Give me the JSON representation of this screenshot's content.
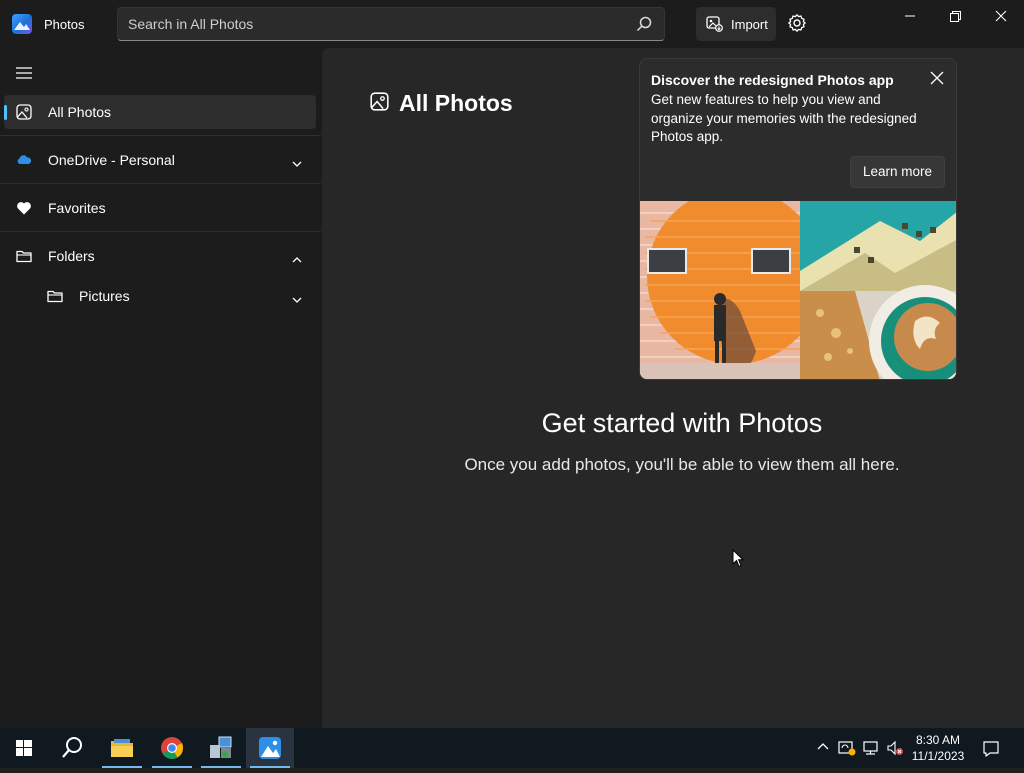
{
  "window": {
    "app_title": "Photos",
    "search_placeholder": "Search in All Photos",
    "import_label": "Import"
  },
  "sidebar": {
    "items": [
      {
        "label": "All Photos",
        "icon": "photo-icon",
        "selected": true
      },
      {
        "label": "OneDrive - Personal",
        "icon": "cloud-icon",
        "expanded": false
      },
      {
        "label": "Favorites",
        "icon": "heart-icon"
      },
      {
        "label": "Folders",
        "icon": "folder-icon",
        "expanded": true
      },
      {
        "label": "Pictures",
        "icon": "folder-icon",
        "expanded": false
      }
    ]
  },
  "main": {
    "page_title": "All Photos",
    "empty_title": "Get started with Photos",
    "empty_subtitle": "Once you add photos, you'll be able to view them all here."
  },
  "tip": {
    "title": "Discover the redesigned Photos app",
    "body": "Get new features to help you view and organize your memories with the redesigned Photos app.",
    "button": "Learn more"
  },
  "taskbar": {
    "apps": [
      "start-icon",
      "search-icon",
      "file-explorer-icon",
      "chrome-icon",
      "control-panel-icon",
      "photos-icon"
    ],
    "time": "8:30 AM",
    "date": "11/1/2023"
  },
  "colors": {
    "accent": "#4cc2ff",
    "background": "#272727",
    "sidebar": "#1c1c1c"
  }
}
